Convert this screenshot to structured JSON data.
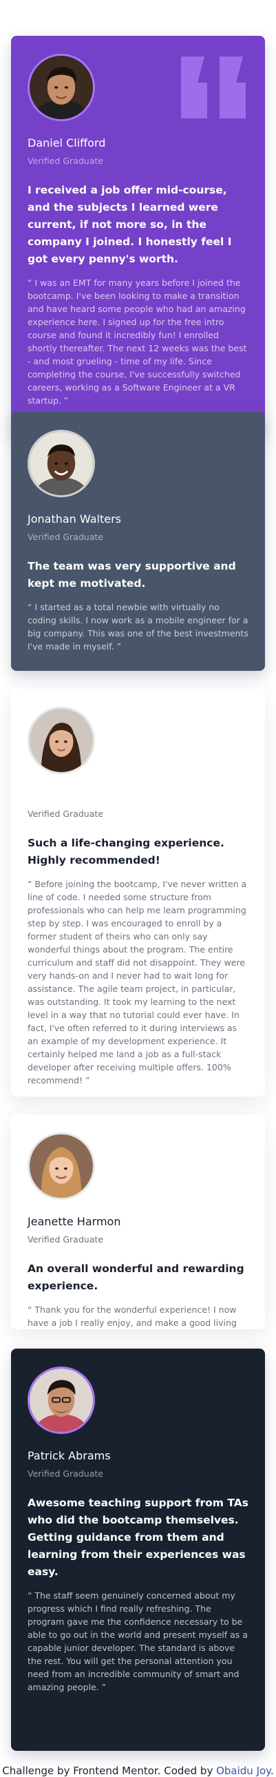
{
  "colors": {
    "purple": "#7541c8",
    "slate": "#48556a",
    "white": "#ffffff",
    "dark": "#19212e",
    "link": "#3e52a3"
  },
  "testimonials": [
    {
      "name": "Daniel Clifford",
      "role": "Verified Graduate",
      "headline": "I received a job offer mid-course, and the subjects I learned were current, if not more so, in the company I joined. I honestly feel I got every penny's worth.",
      "quote": "“ I was an EMT for many years before I joined the bootcamp. I've been looking to make a transition and have heard some people who had an amazing experience here. I signed up for the free intro course and found it incredibly fun! I enrolled shortly thereafter. The next 12 weeks was the best - and most grueling - time of my life. Since completing the course, I've successfully switched careers, working as a Software Engineer at a VR startup. ”",
      "avatar_icon": "avatar-photo"
    },
    {
      "name": "Jonathan Walters",
      "role": "Verified Graduate",
      "headline": "The team was very supportive and kept me motivated.",
      "quote": "“ I started as a total newbie with virtually no coding skills. I now work as a mobile engineer for a big company. This was one of the best investments I've made in myself. ”",
      "avatar_icon": "avatar-photo"
    },
    {
      "name": "",
      "role": "Verified Graduate",
      "headline": "Such a life-changing experience. Highly recommended!",
      "quote": "“ Before joining the bootcamp, I've never written a line of code. I needed some structure from professionals who can help me learn programming step by step. I was encouraged to enroll by a former student of theirs who can only say wonderful things about the program. The entire curriculum and staff did not disappoint. They were very hands-on and I never had to wait long for assistance. The agile team project, in particular, was outstanding. It took my learning to the next level in a way that no tutorial could ever have. In fact, I've often referred to it during interviews as an example of my development experience. It certainly helped me land a job as a full-stack developer after receiving multiple offers. 100% recommend! ”",
      "avatar_icon": "avatar-photo"
    },
    {
      "name": "Jeanette Harmon",
      "role": "Verified Graduate",
      "headline": "An overall wonderful and rewarding experience.",
      "quote": "“ Thank you for the wonderful experience! I now have a job I really enjoy, and make a good living while doing something I love. ”",
      "avatar_icon": "avatar-photo"
    },
    {
      "name": "Patrick Abrams",
      "role": "Verified Graduate",
      "headline": "Awesome teaching support from TAs who did the bootcamp themselves. Getting guidance from them and learning from their experiences was easy.",
      "quote": "“ The staff seem genuinely concerned about my progress which I find really refreshing. The program gave me the confidence necessary to be able to go out in the world and present myself as a capable junior developer. The standard is above the rest. You will get the personal attention you need from an incredible community of smart and amazing people. ”",
      "avatar_icon": "avatar-photo"
    }
  ],
  "footer": {
    "prefix": "Challenge by Frontend Mentor. Coded by ",
    "author": "Obaidu Joy",
    "suffix": "."
  },
  "quote_icon": "quotation-mark-icon"
}
